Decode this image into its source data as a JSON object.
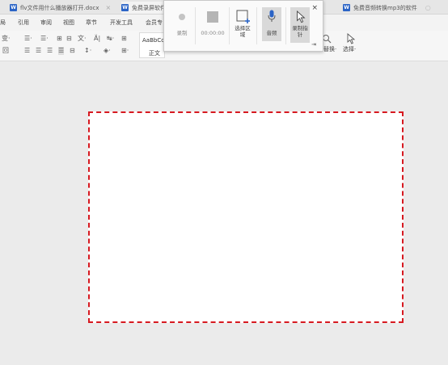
{
  "tabs": [
    {
      "label": "flv文件用什么播放器打开.docx",
      "close": "×",
      "active": false
    },
    {
      "label": "免费录屏软件",
      "close": "",
      "active": true
    },
    {
      "label": "免费音频转换mp3的软件",
      "close": "",
      "more": "○",
      "active": false
    }
  ],
  "menu": [
    "局",
    "引用",
    "审阅",
    "视图",
    "章节",
    "开发工具",
    "会员专"
  ],
  "ribbon": {
    "style_sample": "AaBbCc",
    "style_name": "正文",
    "replace_label": "替换·",
    "select_label": "选择·",
    "glyphs": [
      "变·",
      "回",
      "☰·",
      "☰·",
      "⊞",
      "⊟",
      "文·",
      "Ä|",
      "↹·",
      "⊞",
      "☰",
      "☰",
      "☰",
      "☰",
      "⊟",
      "↕·",
      "◈·",
      "⊞·"
    ]
  },
  "recorder": {
    "record_label": "录制",
    "time_display": "00:00:00",
    "select_area_label": "选择区域",
    "audio_label": "音频",
    "cursor_label": "录制指针",
    "close": "×",
    "pin": "⇥",
    "accent": "#2b64c6"
  },
  "colors": {
    "selection_border": "#d71920",
    "page_background": "#ebebeb"
  }
}
